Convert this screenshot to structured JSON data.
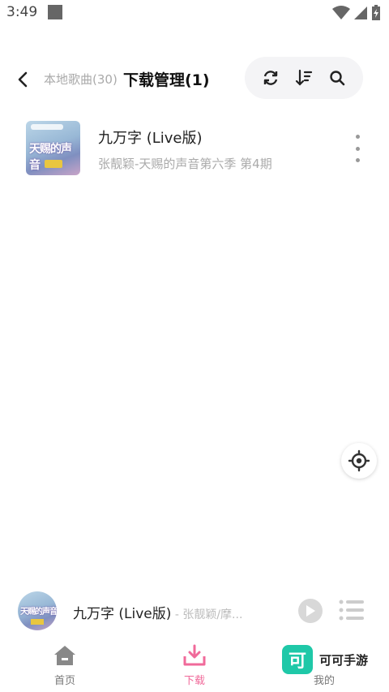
{
  "status": {
    "time": "3:49"
  },
  "header": {
    "local_songs": "本地歌曲(30)",
    "title": "下载管理(1)"
  },
  "songs": [
    {
      "title": "九万字 (Live版)",
      "subtitle": "张靓颖-天赐的声音第六季 第4期",
      "cover_text": "天赐的声音"
    }
  ],
  "player": {
    "title": "九万字 (Live版)",
    "artist": " - 张靓颖/摩..."
  },
  "nav": {
    "items": [
      {
        "label": "首页",
        "icon": "home-icon"
      },
      {
        "label": "下载",
        "icon": "download-icon"
      },
      {
        "label": "我的",
        "icon": "user-icon"
      }
    ],
    "active_color": "#f06a9a"
  },
  "watermark": {
    "logo": "可",
    "text": "可可手游"
  }
}
